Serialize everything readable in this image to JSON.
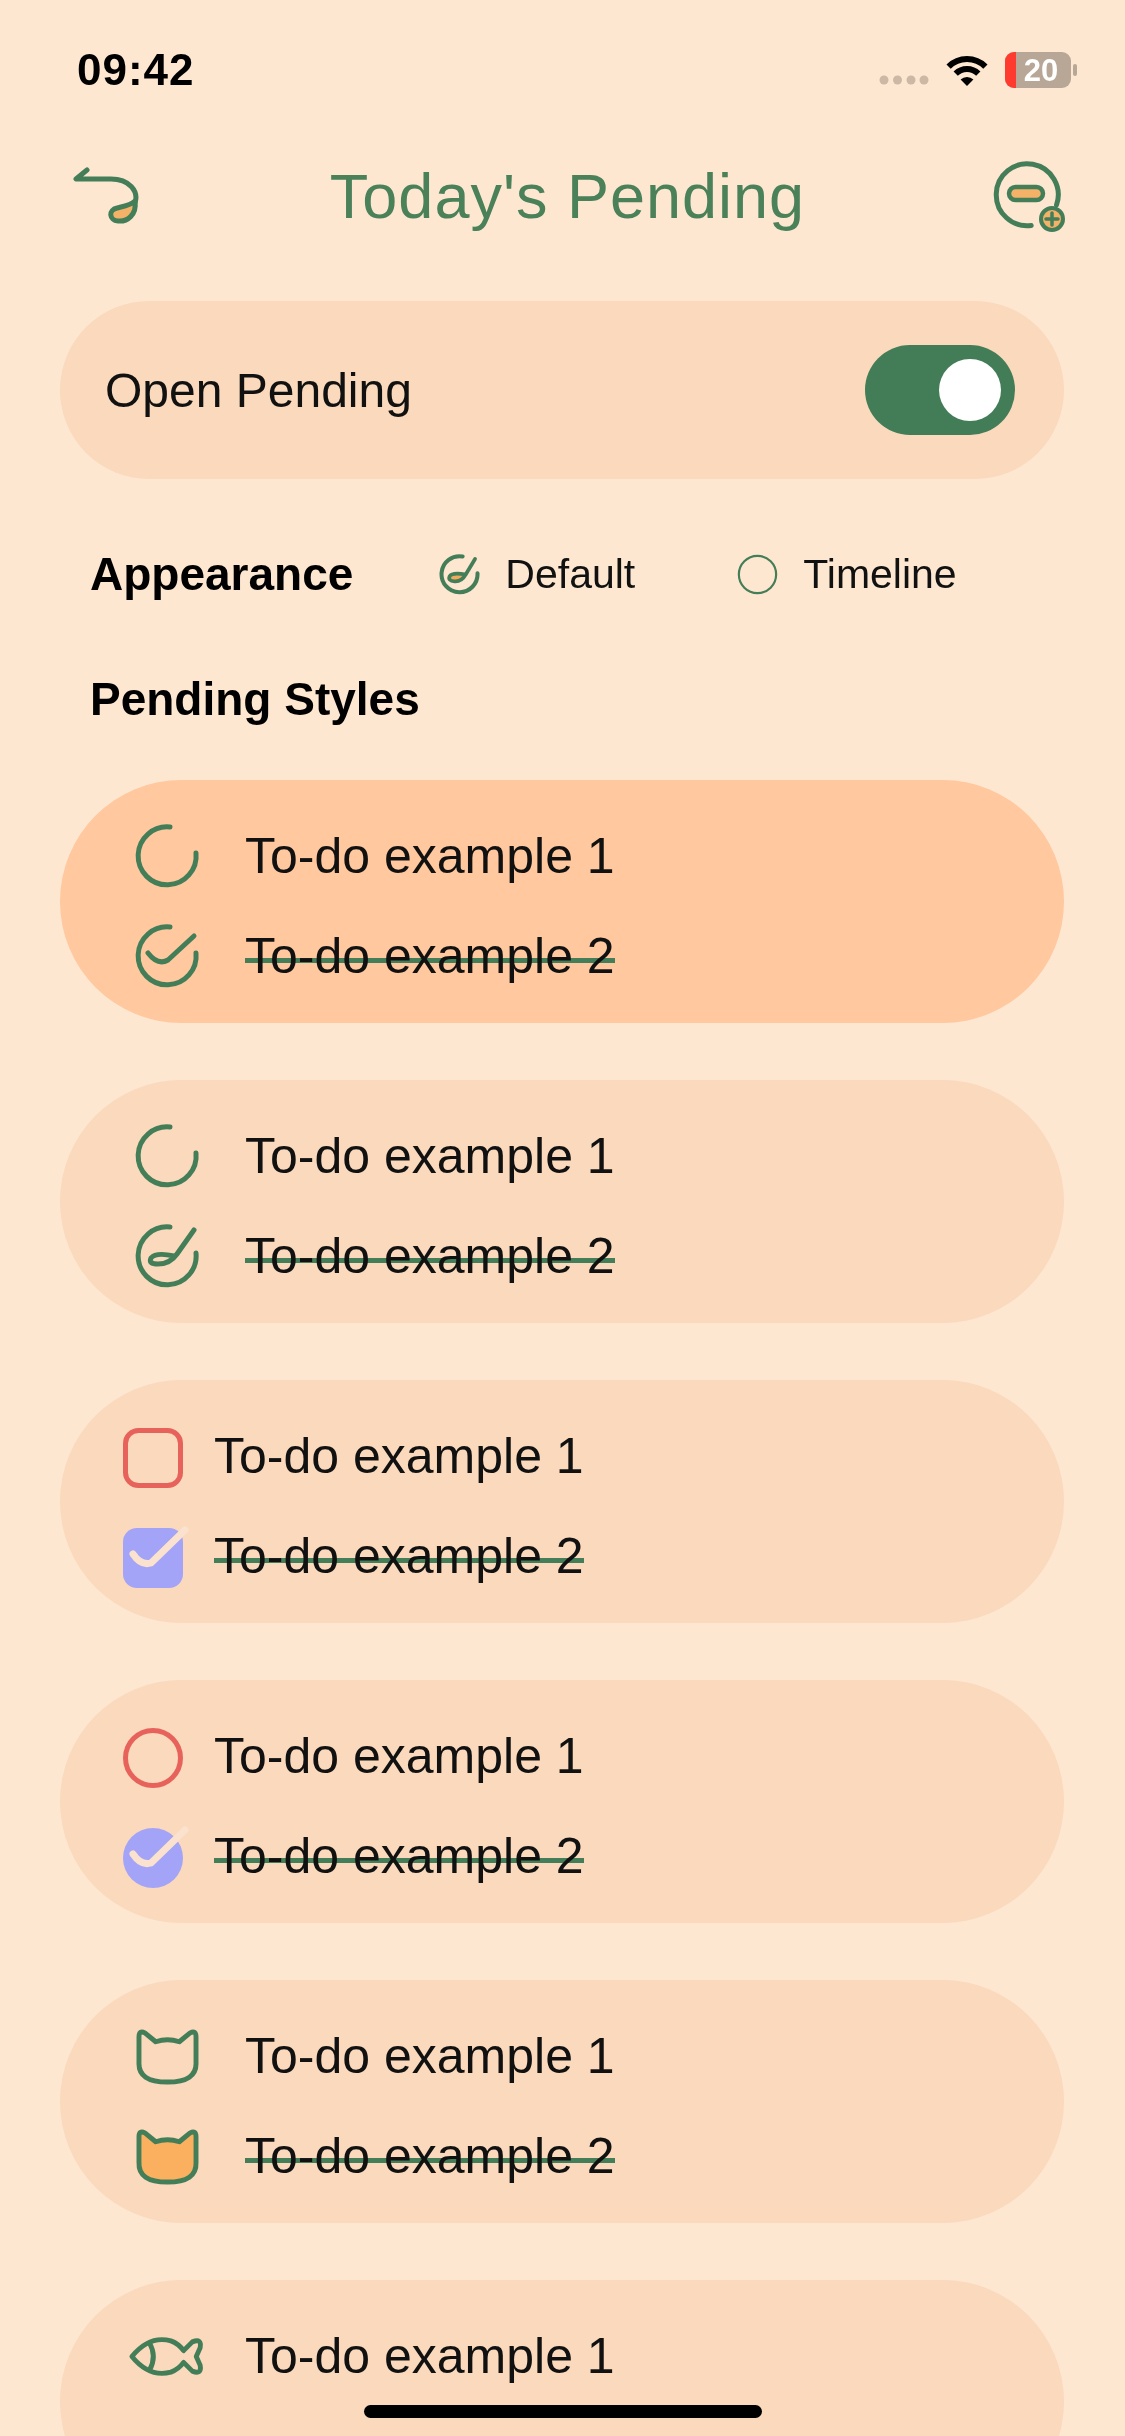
{
  "status_bar": {
    "time": "09:42",
    "battery": "20"
  },
  "header": {
    "title": "Today's Pending"
  },
  "open_pending": {
    "label": "Open Pending",
    "on": true
  },
  "appearance": {
    "label": "Appearance",
    "options": [
      {
        "label": "Default",
        "selected": true
      },
      {
        "label": "Timeline",
        "selected": false
      }
    ]
  },
  "pending_styles": {
    "title": "Pending Styles",
    "styles": [
      {
        "kind": "ring-check",
        "selected": true,
        "items": [
          {
            "text": "To-do example 1",
            "done": false
          },
          {
            "text": "To-do example 2",
            "done": true
          }
        ]
      },
      {
        "kind": "ring-swoosh",
        "selected": false,
        "items": [
          {
            "text": "To-do example 1",
            "done": false
          },
          {
            "text": "To-do example 2",
            "done": true
          }
        ]
      },
      {
        "kind": "square",
        "selected": false,
        "items": [
          {
            "text": "To-do example 1",
            "done": false
          },
          {
            "text": "To-do example 2",
            "done": true
          }
        ]
      },
      {
        "kind": "circle",
        "selected": false,
        "items": [
          {
            "text": "To-do example 1",
            "done": false
          },
          {
            "text": "To-do example 2",
            "done": true
          }
        ]
      },
      {
        "kind": "cat",
        "selected": false,
        "items": [
          {
            "text": "To-do example 1",
            "done": false
          },
          {
            "text": "To-do example 2",
            "done": true
          }
        ]
      },
      {
        "kind": "fish",
        "selected": false,
        "items": [
          {
            "text": "To-do example 1",
            "done": false
          }
        ]
      }
    ]
  }
}
